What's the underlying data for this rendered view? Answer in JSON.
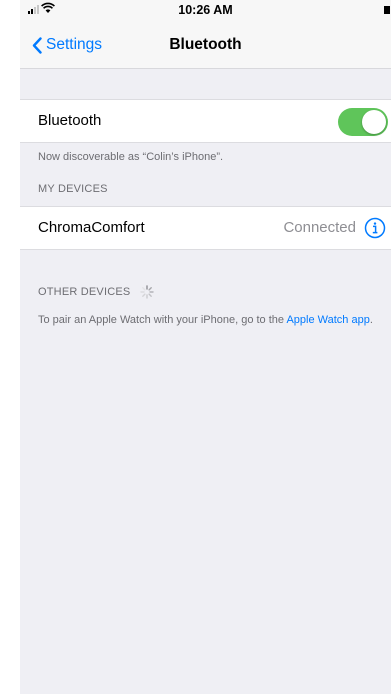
{
  "status_bar": {
    "time": "10:26 AM",
    "signal_icon": "cellular-signal-icon",
    "wifi_icon": "wifi-icon",
    "battery_icon": "battery-icon"
  },
  "nav": {
    "back_label": "Settings",
    "back_icon": "chevron-left-icon",
    "title": "Bluetooth"
  },
  "bluetooth_row": {
    "label": "Bluetooth",
    "toggle_on": true,
    "toggle_color": "#5fc55a"
  },
  "discoverable_note": "Now discoverable as “Colin’s iPhone”.",
  "my_devices": {
    "header": "MY DEVICES",
    "devices": [
      {
        "name": "ChromaComfort",
        "status": "Connected",
        "info_icon": "info-icon"
      }
    ]
  },
  "other_devices": {
    "header": "OTHER DEVICES",
    "spinner_icon": "loading-spinner-icon"
  },
  "watch_note": {
    "text": "To pair an Apple Watch with your iPhone, go to the ",
    "link": "Apple Watch app",
    "suffix": "."
  },
  "colors": {
    "accent": "#007aff",
    "background": "#efeff4",
    "secondary_text": "#6d6d72"
  }
}
